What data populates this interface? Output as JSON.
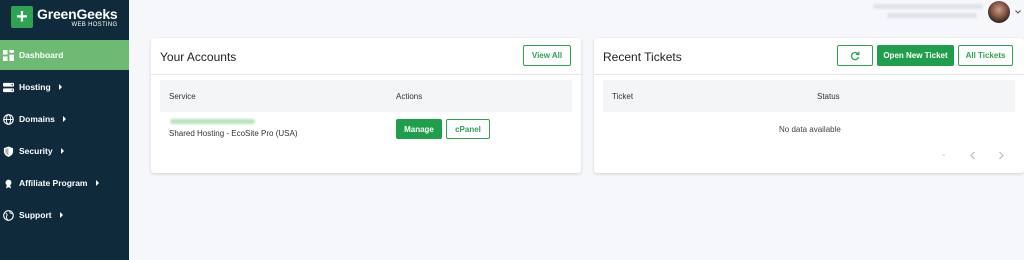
{
  "brand": {
    "name": "GreenGeeks",
    "subtitle": "WEB HOSTING",
    "primary_color": "#2ea352",
    "sidebar_color": "#0f2b3b",
    "active_color": "#6cba73"
  },
  "sidebar": {
    "items": [
      {
        "label": "Dashboard",
        "icon": "dashboard-icon",
        "active": true,
        "has_submenu": false
      },
      {
        "label": "Hosting",
        "icon": "server-icon",
        "active": false,
        "has_submenu": true
      },
      {
        "label": "Domains",
        "icon": "globe-icon",
        "active": false,
        "has_submenu": true
      },
      {
        "label": "Security",
        "icon": "shield-icon",
        "active": false,
        "has_submenu": true
      },
      {
        "label": "Affiliate Program",
        "icon": "affiliate-icon",
        "active": false,
        "has_submenu": true
      },
      {
        "label": "Support",
        "icon": "support-globe-icon",
        "active": false,
        "has_submenu": true
      }
    ]
  },
  "accounts": {
    "title": "Your Accounts",
    "view_all_label": "View All",
    "columns": {
      "service": "Service",
      "actions": "Actions"
    },
    "rows": [
      {
        "service_name": "Shared Hosting - EcoSite Pro (USA)",
        "manage_label": "Manage",
        "cpanel_label": "cPanel"
      }
    ]
  },
  "tickets": {
    "title": "Recent Tickets",
    "refresh_icon": "refresh-icon",
    "open_new_label": "Open New Ticket",
    "all_tickets_label": "All Tickets",
    "columns": {
      "ticket": "Ticket",
      "status": "Status"
    },
    "empty_message": "No data available",
    "pagination": {
      "current": "-",
      "prev_icon": "chevron-left-icon",
      "next_icon": "chevron-right-icon"
    }
  }
}
